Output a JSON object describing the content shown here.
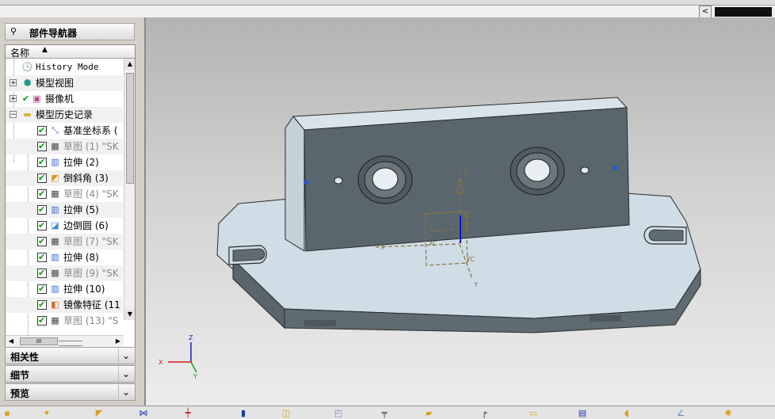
{
  "navigator": {
    "title": "部件导航器",
    "column_header": "名称",
    "tree": [
      {
        "label": "History Mode",
        "icon": "clock-icon",
        "grey": false
      },
      {
        "label": "模型视图",
        "icon": "model-views-icon",
        "grey": false
      },
      {
        "label": "摄像机",
        "icon": "camera-icon",
        "grey": false
      },
      {
        "label": "模型历史记录",
        "icon": "folder-icon",
        "grey": false
      },
      {
        "label": "基准坐标系 (",
        "icon": "datum-csys-icon",
        "grey": false
      },
      {
        "label": "草图 (1) \"SK",
        "icon": "sketch-icon",
        "grey": true
      },
      {
        "label": "拉伸 (2)",
        "icon": "extrude-icon",
        "grey": false
      },
      {
        "label": "倒斜角 (3)",
        "icon": "chamfer-icon",
        "grey": false
      },
      {
        "label": "草图 (4) \"SK",
        "icon": "sketch-icon",
        "grey": true
      },
      {
        "label": "拉伸 (5)",
        "icon": "extrude-icon",
        "grey": false
      },
      {
        "label": "边倒圆 (6)",
        "icon": "edge-blend-icon",
        "grey": false
      },
      {
        "label": "草图 (7) \"SK",
        "icon": "sketch-icon",
        "grey": true
      },
      {
        "label": "拉伸 (8)",
        "icon": "extrude-icon",
        "grey": false
      },
      {
        "label": "草图 (9) \"SK",
        "icon": "sketch-icon",
        "grey": true
      },
      {
        "label": "拉伸 (10)",
        "icon": "extrude-icon",
        "grey": false
      },
      {
        "label": "镜像特征 (11",
        "icon": "mirror-feature-icon",
        "grey": false
      },
      {
        "label": "草图 (13) \"S",
        "icon": "sketch-icon",
        "grey": true
      }
    ],
    "hscroll_thumb": "III",
    "panels": [
      {
        "label": "相关性"
      },
      {
        "label": "细节"
      },
      {
        "label": "预览"
      }
    ]
  },
  "viewport": {
    "triad_labels": {
      "x": "X",
      "y": "Y",
      "z": "Z"
    },
    "sketch_labels": {
      "xc": "XC",
      "yc": "YC",
      "zc": "ZC",
      "x": "X",
      "y": "Y",
      "z": "Z"
    }
  },
  "colors": {
    "model_top": "#cfdde6",
    "model_side": "#5f6b72",
    "model_face_dark": "#4f5a61",
    "background_top": "#b3b3b3",
    "background_bottom": "#ececec",
    "check_green": "#00a000"
  }
}
